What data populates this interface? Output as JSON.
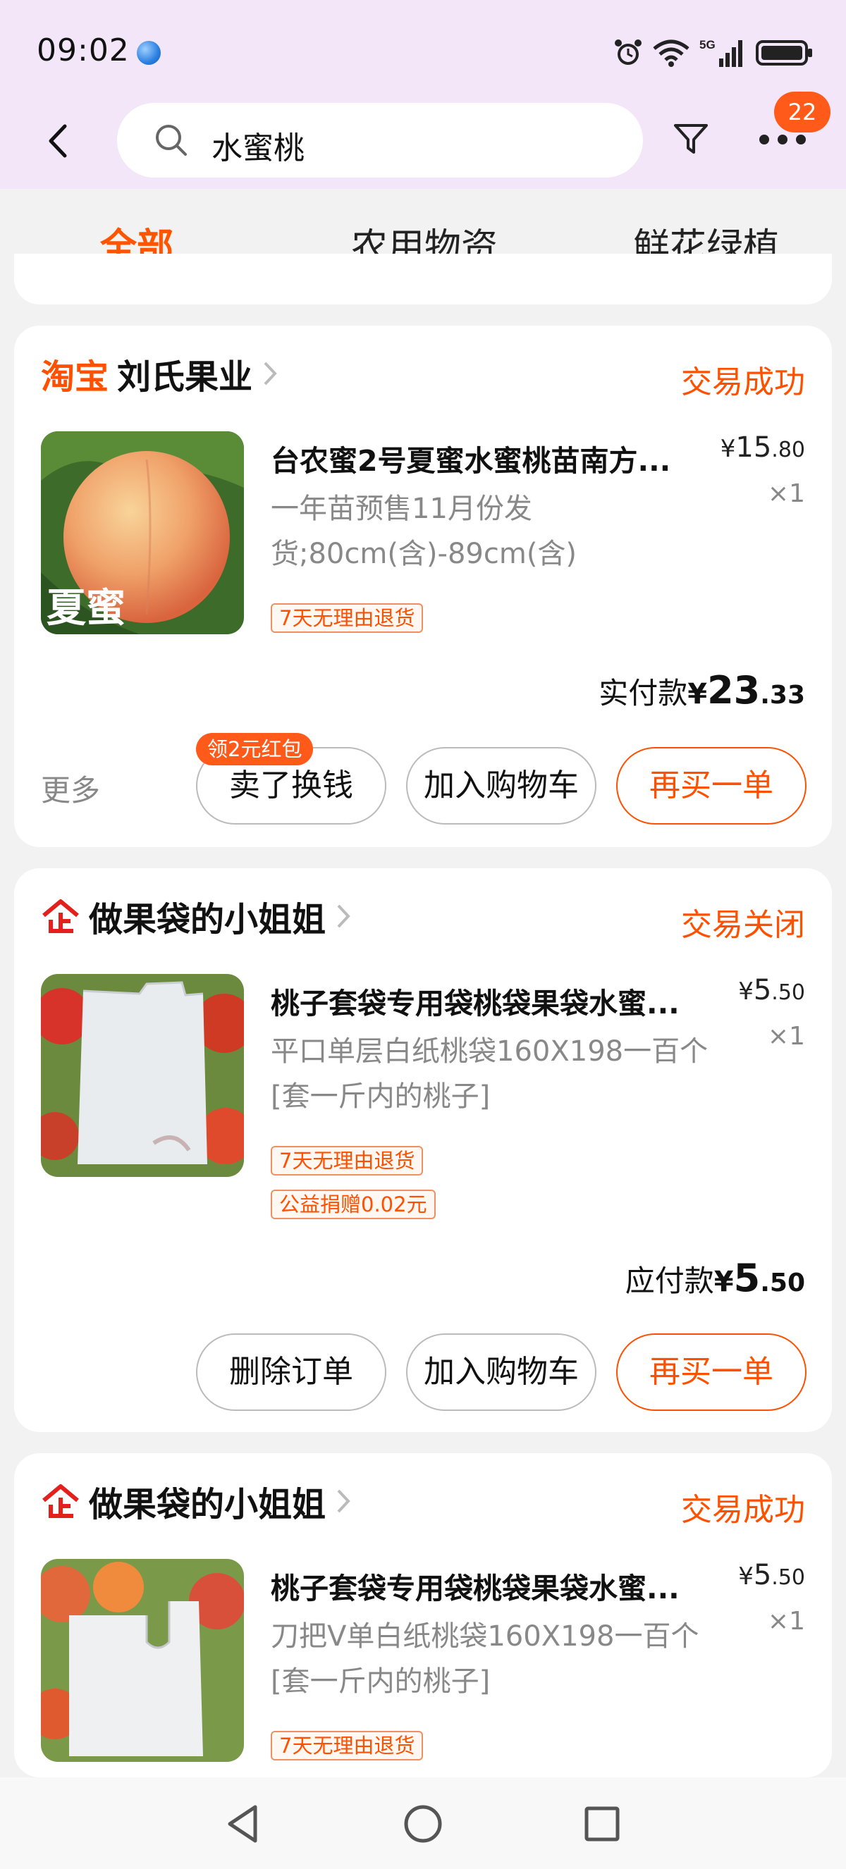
{
  "status_bar": {
    "time": "09:02",
    "network": "5G"
  },
  "search": {
    "query": "水蜜桃",
    "badge_count": "22"
  },
  "tabs": [
    {
      "label": "全部",
      "active": true
    },
    {
      "label": "农用物资",
      "active": false
    },
    {
      "label": "鲜花绿植",
      "active": false
    }
  ],
  "orders": [
    {
      "brand": "淘宝",
      "shop": "刘氏果业",
      "status": "交易成功",
      "title": "台农蜜2号夏蜜水蜜桃苗南方...",
      "spec": "一年苗预售11月份发货;80cm(含)-89cm(含)",
      "price_int": "15",
      "price_dec": ".80",
      "qty": "×1",
      "tags": [
        "7天无理由退货"
      ],
      "thumb_caption": "夏蜜",
      "paid_label": "实付款",
      "paid_int": "23",
      "paid_dec": ".33",
      "more_label": "更多",
      "promo": "领2元红包",
      "buttons": [
        "卖了换钱",
        "加入购物车",
        "再买一单"
      ]
    },
    {
      "brand": "",
      "shop": "做果袋的小姐姐",
      "status": "交易关闭",
      "title": "桃子套袋专用袋桃袋果袋水蜜...",
      "spec": "平口单层白纸桃袋160X198一百个[套一斤内的桃子]",
      "price_int": "5",
      "price_dec": ".50",
      "qty": "×1",
      "tags": [
        "7天无理由退货",
        "公益捐赠0.02元"
      ],
      "paid_label": "应付款",
      "paid_int": "5",
      "paid_dec": ".50",
      "buttons": [
        "删除订单",
        "加入购物车",
        "再买一单"
      ]
    },
    {
      "brand": "",
      "shop": "做果袋的小姐姐",
      "status": "交易成功",
      "title": "桃子套袋专用袋桃袋果袋水蜜...",
      "spec": "刀把V单白纸桃袋160X198一百个[套一斤内的桃子]",
      "price_int": "5",
      "price_dec": ".50",
      "qty": "×1",
      "tags": [
        "7天无理由退货"
      ]
    }
  ],
  "colors": {
    "accent": "#ff5000",
    "header_bg": "#f2e6f8",
    "page_bg": "#f2f2f2"
  },
  "icons": [
    "back-arrow-icon",
    "search-icon",
    "filter-icon",
    "more-dots-icon",
    "alarm-icon",
    "wifi-icon",
    "signal-icon",
    "battery-icon",
    "chevron-right-icon",
    "qi-shop-icon",
    "nav-back-icon",
    "nav-home-icon",
    "nav-recents-icon"
  ]
}
